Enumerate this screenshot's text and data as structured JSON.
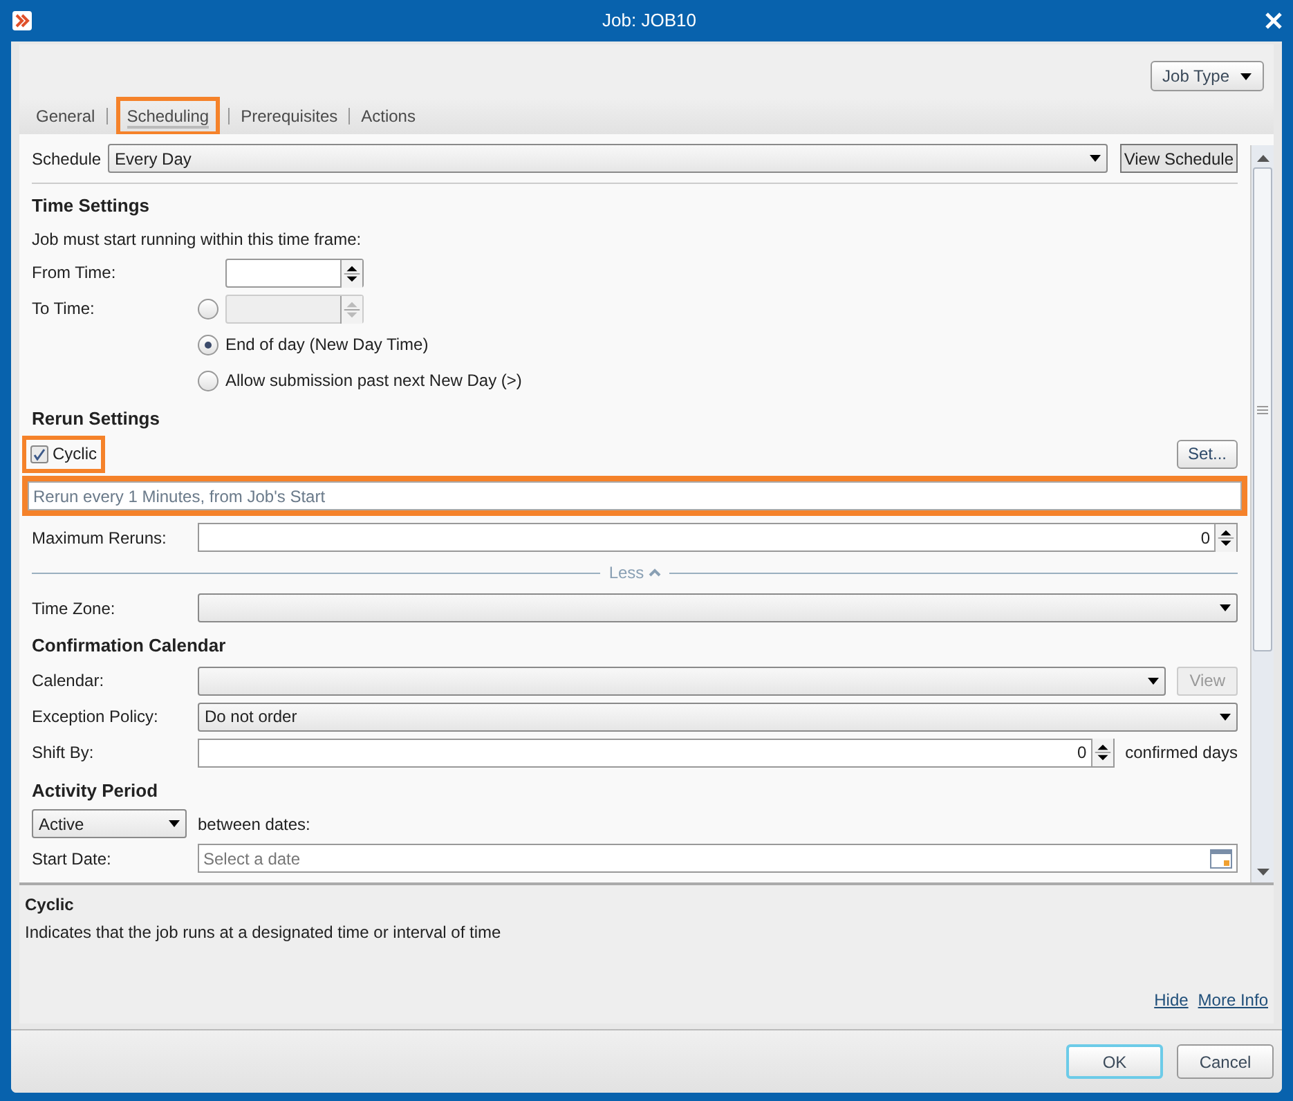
{
  "window": {
    "title": "Job: JOB10"
  },
  "job_type_button": "Job Type",
  "tabs": [
    {
      "label": "General",
      "selected": false
    },
    {
      "label": "Scheduling",
      "selected": true
    },
    {
      "label": "Prerequisites",
      "selected": false
    },
    {
      "label": "Actions",
      "selected": false
    }
  ],
  "schedule": {
    "label": "Schedule",
    "value": "Every Day",
    "button": "View Schedule"
  },
  "time_settings": {
    "heading": "Time Settings",
    "intro": "Job must start running within this time frame:",
    "from_label": "From Time:",
    "to_label": "To Time:",
    "options": [
      {
        "kind": "time",
        "selected": false
      },
      {
        "kind": "text",
        "label": "End of day (New Day Time)",
        "selected": true
      },
      {
        "kind": "text",
        "label": "Allow submission past next New Day (>)",
        "selected": false
      }
    ]
  },
  "rerun": {
    "heading": "Rerun Settings",
    "cyclic": {
      "label": "Cyclic",
      "checked": true,
      "highlighted": true
    },
    "set_button": "Set...",
    "summary": {
      "value": "Rerun every 1 Minutes, from Job's Start",
      "highlighted": true
    },
    "max_label": "Maximum Reruns:",
    "max_value": "0"
  },
  "less_toggle": "Less",
  "time_zone": {
    "label": "Time Zone:"
  },
  "confirmation": {
    "heading": "Confirmation Calendar",
    "calendar_label": "Calendar:",
    "view_button": {
      "label": "View",
      "disabled": true
    },
    "exception_label": "Exception Policy:",
    "exception_value": "Do not order",
    "shift_label": "Shift By:",
    "shift_value": "0",
    "shift_suffix": "confirmed days"
  },
  "activity": {
    "heading": "Activity Period",
    "mode": "Active",
    "between": "between dates:",
    "start_label": "Start Date:",
    "start_placeholder": "Select a date"
  },
  "help": {
    "title": "Cyclic",
    "text": "Indicates that the job runs at a designated time or interval of time",
    "links": [
      "Hide",
      "More Info"
    ]
  },
  "buttons": [
    "OK",
    "Cancel"
  ]
}
